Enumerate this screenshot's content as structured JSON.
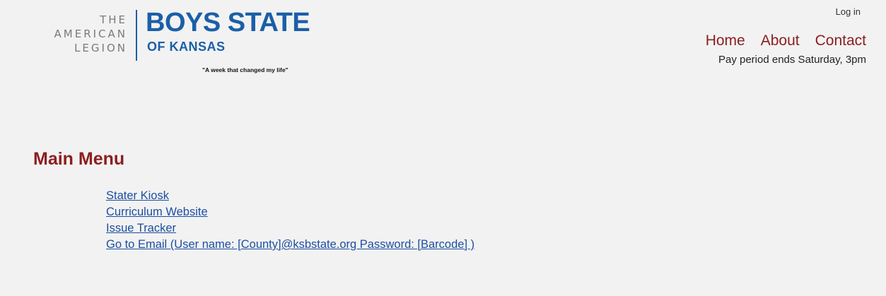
{
  "logo": {
    "legion_lines": [
      "THE",
      "AMERICAN",
      "LEGION"
    ],
    "title": "BOYS STATE",
    "subtitle": "OF KANSAS",
    "tagline": "\"A week that changed my life\""
  },
  "header": {
    "login_label": "Log in",
    "nav": [
      "Home",
      "About",
      "Contact"
    ],
    "pay_period": "Pay period ends Saturday, 3pm"
  },
  "main": {
    "title": "Main Menu",
    "links": [
      "Stater Kiosk",
      "Curriculum Website",
      "Issue Tracker",
      "Go to Email (User name: [County]@ksbstate.org Password: [Barcode] )"
    ]
  },
  "colors": {
    "background": "#f2f2f2",
    "brand_blue": "#1a5fa8",
    "accent_red": "#8b1e1e",
    "link_blue": "#1c4fa1"
  }
}
